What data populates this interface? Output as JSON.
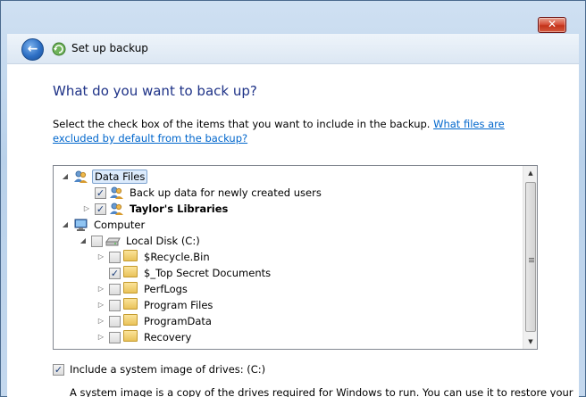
{
  "window": {
    "close_glyph": "✕",
    "back_glyph": "←",
    "title": "Set up backup"
  },
  "page": {
    "heading": "What do you want to back up?",
    "instruction": "Select the check box of the items that you want to include in the backup. ",
    "link": "What files are excluded by default from the backup?"
  },
  "tree": {
    "items": [
      {
        "label": "Data Files",
        "expander": "◢",
        "checkbox": null,
        "icon": "users-icon",
        "selected": true
      },
      {
        "label": "Back up data for newly created users",
        "expander": "",
        "checkbox": "✓",
        "icon": "users-icon"
      },
      {
        "label": "Taylor's Libraries",
        "expander": "▷",
        "checkbox": "✓",
        "icon": "users-icon",
        "bold": true
      },
      {
        "label": "Computer",
        "expander": "◢",
        "checkbox": null,
        "icon": "computer-icon"
      },
      {
        "label": "Local Disk (C:)",
        "expander": "◢",
        "checkbox": "",
        "icon": "drive-icon"
      },
      {
        "label": "$Recycle.Bin",
        "expander": "▷",
        "checkbox": "",
        "icon": "folder-icon"
      },
      {
        "label": "$_Top Secret Documents",
        "expander": "",
        "checkbox": "✓",
        "icon": "folder-icon"
      },
      {
        "label": "PerfLogs",
        "expander": "▷",
        "checkbox": "",
        "icon": "folder-icon"
      },
      {
        "label": "Program Files",
        "expander": "▷",
        "checkbox": "",
        "icon": "folder-icon"
      },
      {
        "label": "ProgramData",
        "expander": "▷",
        "checkbox": "",
        "icon": "folder-icon"
      },
      {
        "label": "Recovery",
        "expander": "▷",
        "checkbox": "",
        "icon": "folder-icon"
      }
    ],
    "scroll_up": "▲",
    "scroll_down": "▼"
  },
  "system_image": {
    "checked": "✓",
    "label": "Include a system image of drives: (C:)",
    "description": "A system image is a copy of the drives required for Windows to run. You can use it to restore your"
  }
}
